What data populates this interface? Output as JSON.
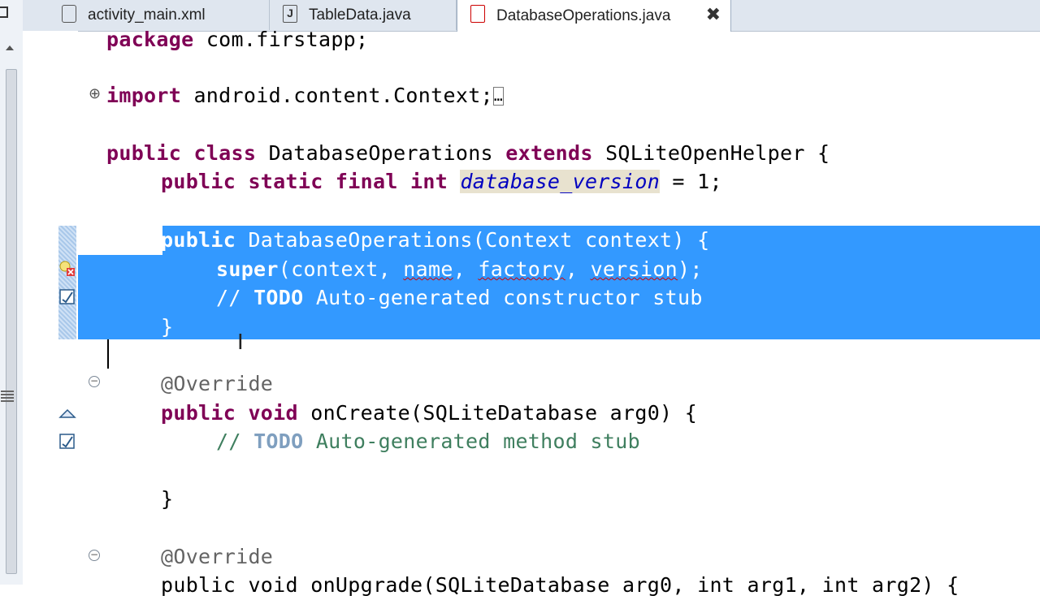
{
  "tabs": [
    {
      "label": "activity_main.xml",
      "icon": "xml-file-icon",
      "active": false
    },
    {
      "label": "TableData.java",
      "icon": "java-file-icon",
      "active": false
    },
    {
      "label": "DatabaseOperations.java",
      "icon": "java-file-error-icon",
      "active": true,
      "close": "✖"
    }
  ],
  "code": {
    "l1": {
      "kw": "package",
      "rest": " com.firstapp;"
    },
    "l2": {
      "kw": "import",
      "rest": " android.content.Context;",
      "fold_marker": "⊕",
      "collapsed": "…"
    },
    "l3": {
      "kw1": "public",
      "kw2": "class",
      "name": " DatabaseOperations ",
      "kw3": "extends",
      "rest": " SQLiteOpenHelper {"
    },
    "l4": {
      "kw": "public static final int",
      "field": "database_version",
      "rest": " = 1;"
    },
    "l5": {
      "kw": "public",
      "rest": " DatabaseOperations(Context context) {"
    },
    "l6": {
      "kw": "super",
      "p1": "(context, ",
      "a1": "name",
      "p2": ", ",
      "a2": "factory",
      "p3": ", ",
      "a3": "version",
      "p4": ");"
    },
    "l7": {
      "prefix": "// ",
      "todo": "TODO",
      "rest": " Auto-generated constructor stub"
    },
    "l8": {
      "text": "}"
    },
    "l9": {
      "text": "@Override"
    },
    "l10": {
      "kw": "public void",
      "rest": " onCreate(SQLiteDatabase arg0) {"
    },
    "l11": {
      "prefix": "// ",
      "todo": "TODO",
      "rest": " Auto-generated method stub"
    },
    "l12": {
      "text": "}"
    },
    "l13": {
      "text": "@Override"
    },
    "l14": {
      "text": "public void onUpgrade(SQLiteDatabase arg0, int arg1, int arg2) {"
    }
  },
  "colors": {
    "selection": "#3399ff",
    "keyword": "#7f0055",
    "comment": "#3f7f5f",
    "field": "#0000c0"
  }
}
